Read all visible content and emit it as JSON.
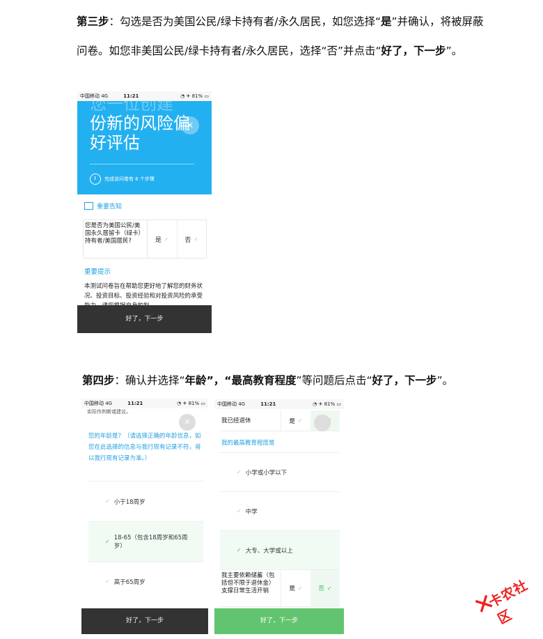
{
  "step3": {
    "label": "第三步",
    "text_a": "：勾选是否为美国公民/绿卡持有者/永久居民，如您选择“",
    "yes": "是",
    "text_b": "”并确认，将被屏蔽问卷。如您非美国公民/绿卡持有者/永久居民，选择“否”并点击“",
    "button": "好了，下一步",
    "text_c": "”。"
  },
  "step4": {
    "label": "第四步",
    "text_a": "：确认并选择“",
    "age": "年龄",
    "text_b": "”，“",
    "edu": "最高教育程度",
    "text_c": "”等问题后点击“",
    "button": "好了，下一步",
    "text_d": "”。"
  },
  "phone1": {
    "status": {
      "carrier": "中国移动 4G",
      "time": "11:21",
      "right": "◔ ✈ 81% ▭"
    },
    "hero_title_ghost": "您一位创建",
    "hero_title": "份新的风险偏好评估",
    "hero_steps": "完成该问卷有 6 个步骤",
    "close": "✕",
    "notice": "重要告知",
    "question": "您是否为美国公民/美国永久居留卡（绿卡）持有者/美国居民?",
    "opt_yes": "是",
    "opt_no": "否",
    "tip_title": "重要提示",
    "tip_body": "本测试问卷旨在帮助您更好地了解您的财务状况、投资目标、投资经验和对投资风险的承受能力，请您根据自身的判",
    "button": "好了，下一步"
  },
  "phone2": {
    "status": {
      "carrier": "中国移动 4G",
      "time": "11:21",
      "right": "◔ ✈ 81% ▭"
    },
    "cut_text": "实际作判断或建议。",
    "close": "✕",
    "question": "您的年龄是？（请选择正确的年龄信息，如您在此选择的信息与我行现有记录不符，将以我行现有记录为准。）",
    "options": [
      "小于18周岁",
      "18-65（包含18周岁和65周岁）",
      "高于65周岁"
    ],
    "button": "好了，下一步"
  },
  "phone3": {
    "status": {
      "carrier": "中国移动 4G",
      "time": "11:21",
      "right": "◔ ✈ 81% ▭"
    },
    "retired_label": "我已经退休",
    "opt_yes": "是",
    "opt_no": "否",
    "section": "我的最高教育程度是",
    "options": [
      "小学或小学以下",
      "中学",
      "大专、大学或以上"
    ],
    "savings_label": "我主要依赖储蓄（包括但不限于退休金）支撑日常生活开销",
    "button": "好了，下一步"
  },
  "watermark": {
    "mark": "✕",
    "text": "卡农社区"
  },
  "colors": {
    "accent_blue": "#23b0f0",
    "button_dark": "#333333",
    "button_green": "#62c46f",
    "check_green": "#3dbb66",
    "watermark_red": "#e22222"
  }
}
